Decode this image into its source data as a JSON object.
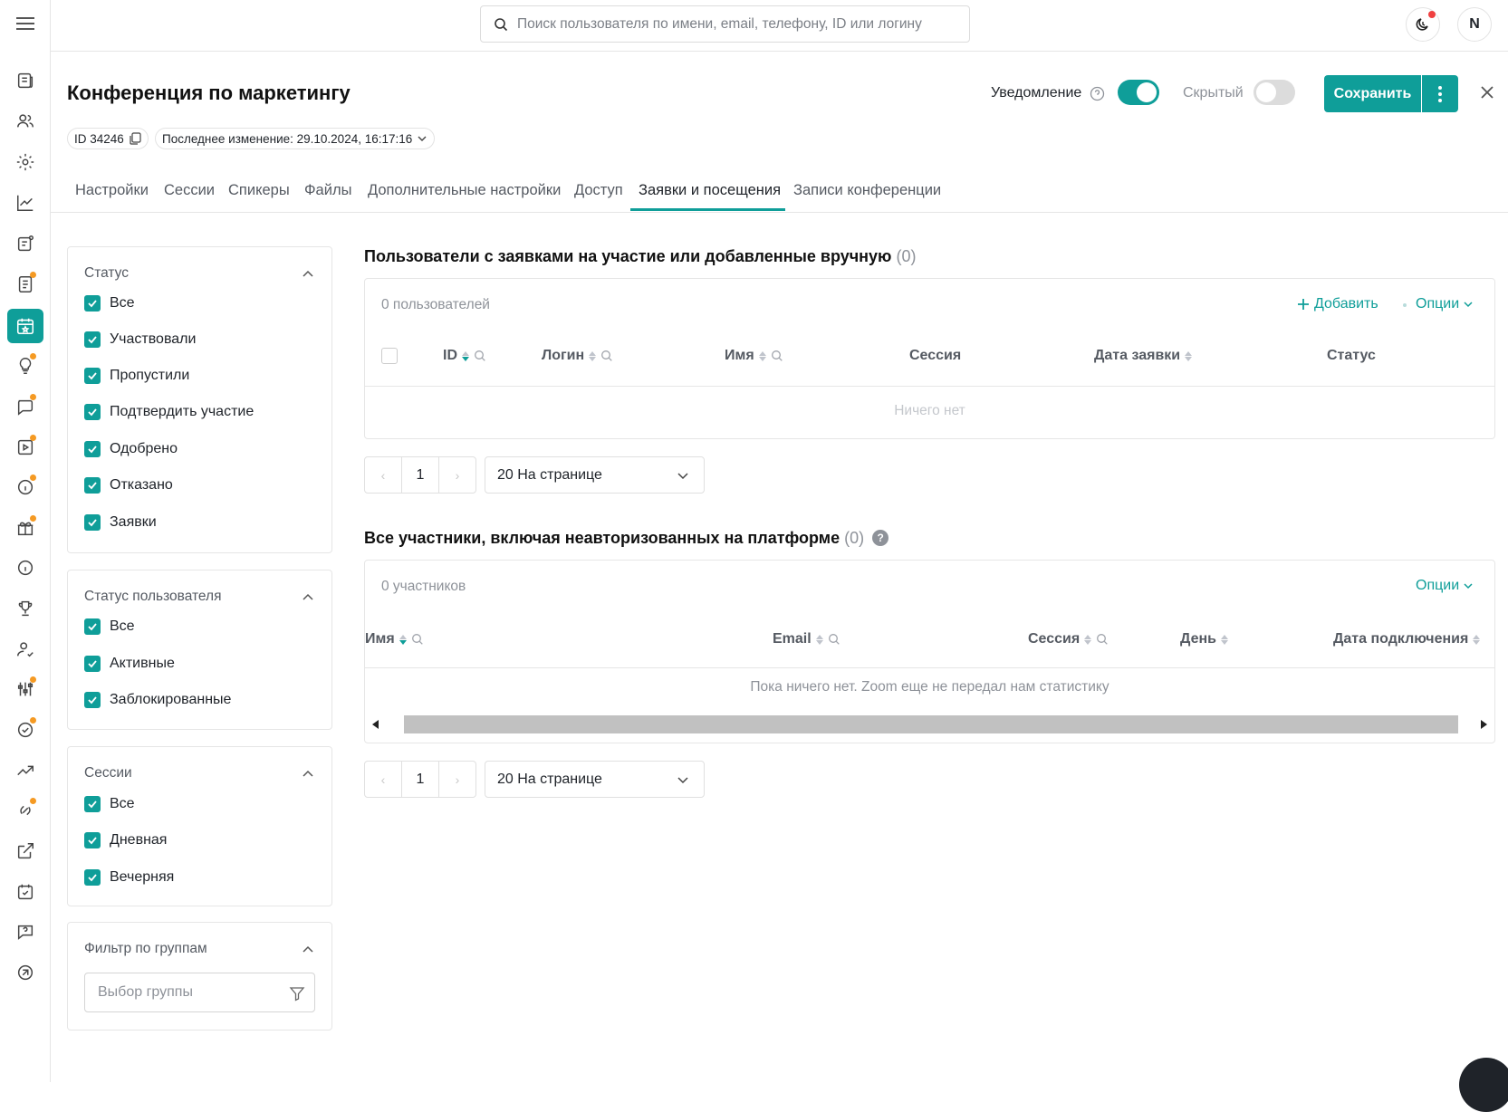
{
  "search": {
    "placeholder": "Поиск пользователя по имени, email, телефону, ID или логину"
  },
  "user": {
    "initial": "N"
  },
  "page": {
    "title": "Конференция по маркетингу",
    "id_label": "ID 34246",
    "last_modified": "Последнее изменение: 29.10.2024, 16:17:16"
  },
  "toggles": {
    "notification_label": "Уведомление",
    "notification_on": true,
    "hidden_label": "Скрытый",
    "hidden_on": false
  },
  "actions": {
    "save_label": "Сохранить"
  },
  "tabs": [
    {
      "label": "Настройки"
    },
    {
      "label": "Сессии"
    },
    {
      "label": "Спикеры"
    },
    {
      "label": "Файлы"
    },
    {
      "label": "Дополнительные настройки"
    },
    {
      "label": "Доступ"
    },
    {
      "label": "Заявки и посещения",
      "active": true
    },
    {
      "label": "Записи конференции"
    }
  ],
  "filters": {
    "status": {
      "title": "Статус",
      "items": [
        "Все",
        "Участвовали",
        "Пропустили",
        "Подтвердить участие",
        "Одобрено",
        "Отказано",
        "Заявки"
      ]
    },
    "user_status": {
      "title": "Статус пользователя",
      "items": [
        "Все",
        "Активные",
        "Заблокированные"
      ]
    },
    "sessions": {
      "title": "Сессии",
      "items": [
        "Все",
        "Дневная",
        "Вечерняя"
      ]
    },
    "groups": {
      "title": "Фильтр по группам",
      "placeholder": "Выбор группы"
    }
  },
  "section1": {
    "title": "Пользователи с заявками на участие или добавленные вручную",
    "count": "(0)",
    "users_count": "0 пользователей",
    "add_label": "Добавить",
    "options_label": "Опции",
    "columns": [
      "ID",
      "Логин",
      "Имя",
      "Сессия",
      "Дата заявки",
      "Статус"
    ],
    "empty_text": "Ничего нет",
    "page": "1",
    "per_page": "20 На странице"
  },
  "section2": {
    "title": "Все участники, включая неавторизованных на платформе",
    "count": "(0)",
    "participants_count": "0 участников",
    "options_label": "Опции",
    "columns": [
      "Имя",
      "Email",
      "Сессия",
      "День",
      "Дата подключения"
    ],
    "empty_text": "Пока ничего нет. Zoom еще не передал нам статистику",
    "page": "1",
    "per_page": "20 На странице"
  },
  "colors": {
    "accent": "#0f9e99",
    "badge": "#f59a23",
    "alert": "#f04040"
  }
}
